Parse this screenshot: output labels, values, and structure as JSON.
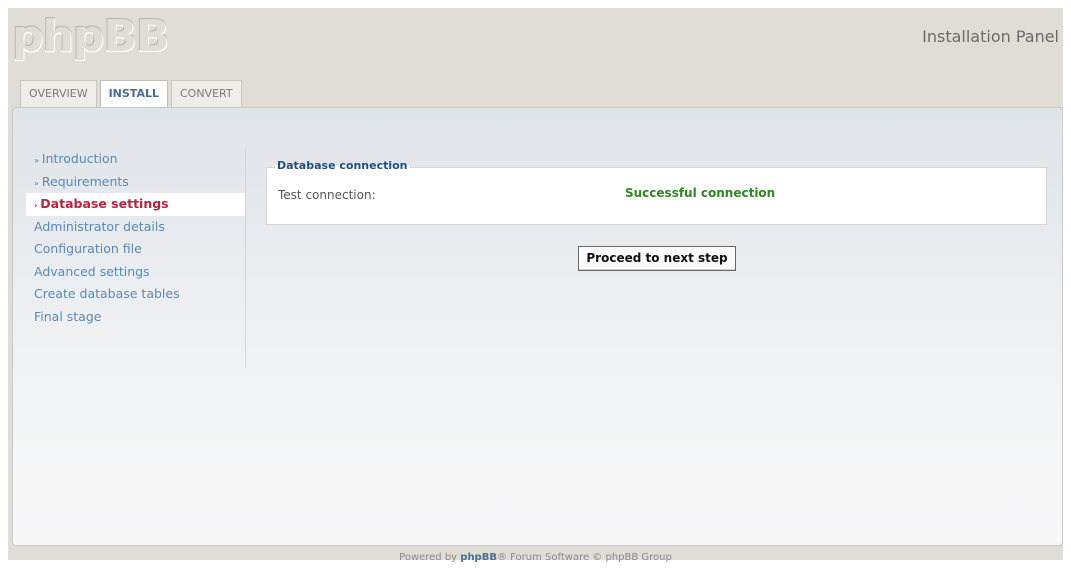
{
  "header": {
    "logo_text": "phpBB",
    "panel_title": "Installation Panel"
  },
  "tabs": [
    {
      "label": "OVERVIEW",
      "active": false
    },
    {
      "label": "INSTALL",
      "active": true
    },
    {
      "label": "CONVERT",
      "active": false
    }
  ],
  "sidebar": {
    "items": [
      {
        "label": "Introduction",
        "state": "completed",
        "marker": "»"
      },
      {
        "label": "Requirements",
        "state": "completed",
        "marker": "»"
      },
      {
        "label": "Database settings",
        "state": "active",
        "marker": "›"
      },
      {
        "label": "Administrator details",
        "state": "pending"
      },
      {
        "label": "Configuration file",
        "state": "pending"
      },
      {
        "label": "Advanced settings",
        "state": "pending"
      },
      {
        "label": "Create database tables",
        "state": "pending"
      },
      {
        "label": "Final stage",
        "state": "pending"
      }
    ]
  },
  "main": {
    "fieldset_legend": "Database connection",
    "field_label": "Test connection:",
    "field_value": "Successful connection",
    "submit_label": "Proceed to next step"
  },
  "footer": {
    "prefix": "Powered by ",
    "brand": "phpBB",
    "suffix": "® Forum Software © phpBB Group"
  },
  "colors": {
    "active_tab_text": "#4a6e91",
    "active_sidebar_text": "#b5263e",
    "success_text": "#2a8a1f",
    "legend_text": "#1f4f80",
    "link_text": "#5a89b5"
  }
}
